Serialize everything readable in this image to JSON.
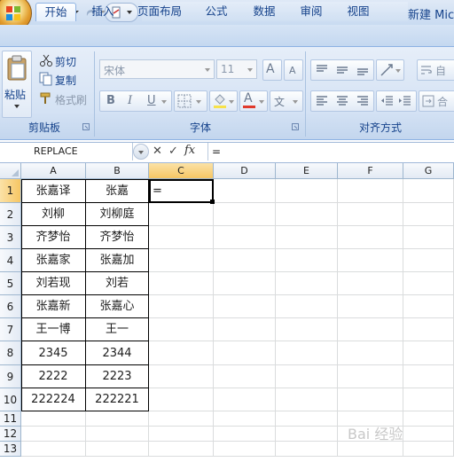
{
  "title_bar": {
    "doc_title": "新建 Micr"
  },
  "tabs": [
    "开始",
    "插入",
    "页面布局",
    "公式",
    "数据",
    "审阅",
    "视图"
  ],
  "ribbon": {
    "clipboard": {
      "paste": "粘贴",
      "cut": "剪切",
      "copy": "复制",
      "format_painter": "格式刷",
      "label": "剪贴板"
    },
    "font": {
      "font_name": "宋体",
      "font_size": "11",
      "bold": "B",
      "italic": "I",
      "underline": "U",
      "font_color_glyph": "A",
      "phonetic": "文",
      "label": "字体",
      "grow": "A",
      "shrink": "A"
    },
    "alignment": {
      "label": "对齐方式",
      "wrap": "自",
      "merge": "合"
    }
  },
  "formula_bar": {
    "name_box": "REPLACE",
    "cancel": "✕",
    "enter": "✓",
    "fx": "fx",
    "content": "="
  },
  "columns": [
    "A",
    "B",
    "C",
    "D",
    "E",
    "F",
    "G"
  ],
  "rows": [
    "1",
    "2",
    "3",
    "4",
    "5",
    "6",
    "7",
    "8",
    "9",
    "10",
    "11",
    "12",
    "13"
  ],
  "cells": [
    [
      "张嘉译",
      "张嘉"
    ],
    [
      "刘柳",
      "刘柳庭"
    ],
    [
      "齐梦怡",
      "齐梦怡"
    ],
    [
      "张嘉家",
      "张嘉加"
    ],
    [
      "刘若现",
      "刘若"
    ],
    [
      "张嘉新",
      "张嘉心"
    ],
    [
      "王一博",
      "王一"
    ],
    [
      "2345",
      "2344"
    ],
    [
      "2222",
      "2223"
    ],
    [
      "222224",
      "222221"
    ]
  ],
  "active_cell": {
    "address": "C1",
    "value": "="
  },
  "watermark": "Bai 经验"
}
